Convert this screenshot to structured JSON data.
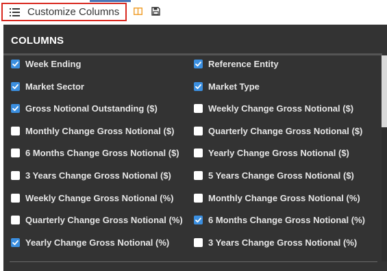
{
  "toolbar": {
    "customize_label": "Customize Columns"
  },
  "panel": {
    "title": "COLUMNS",
    "columns": [
      {
        "label": "Week Ending",
        "checked": true
      },
      {
        "label": "Reference Entity",
        "checked": true
      },
      {
        "label": "Market Sector",
        "checked": true
      },
      {
        "label": "Market Type",
        "checked": true
      },
      {
        "label": "Gross Notional Outstanding ($)",
        "checked": true
      },
      {
        "label": "Weekly Change Gross Notional ($)",
        "checked": false
      },
      {
        "label": "Monthly Change Gross Notional ($)",
        "checked": false
      },
      {
        "label": "Quarterly Change Gross Notional ($)",
        "checked": false
      },
      {
        "label": "6 Months Change Gross Notional ($)",
        "checked": false
      },
      {
        "label": "Yearly Change Gross Notional ($)",
        "checked": false
      },
      {
        "label": "3 Years Change Gross Notional ($)",
        "checked": false
      },
      {
        "label": "5 Years Change Gross Notional ($)",
        "checked": false
      },
      {
        "label": "Weekly Change Gross Notional (%)",
        "checked": false
      },
      {
        "label": "Monthly Change Gross Notional (%)",
        "checked": false
      },
      {
        "label": "Quarterly Change Gross Notional (%)",
        "checked": false
      },
      {
        "label": "6 Months Change Gross Notional (%)",
        "checked": true
      },
      {
        "label": "Yearly Change Gross Notional (%)",
        "checked": true
      },
      {
        "label": "3 Years Change Gross Notional (%)",
        "checked": false
      }
    ]
  },
  "icons": {
    "customize": "list-icon",
    "book": "book-icon",
    "save": "save-icon"
  },
  "colors": {
    "accent": "#3b8fe0",
    "panel_bg": "#333333",
    "highlight_border": "#d9281f",
    "book_icon": "#f0a030"
  }
}
